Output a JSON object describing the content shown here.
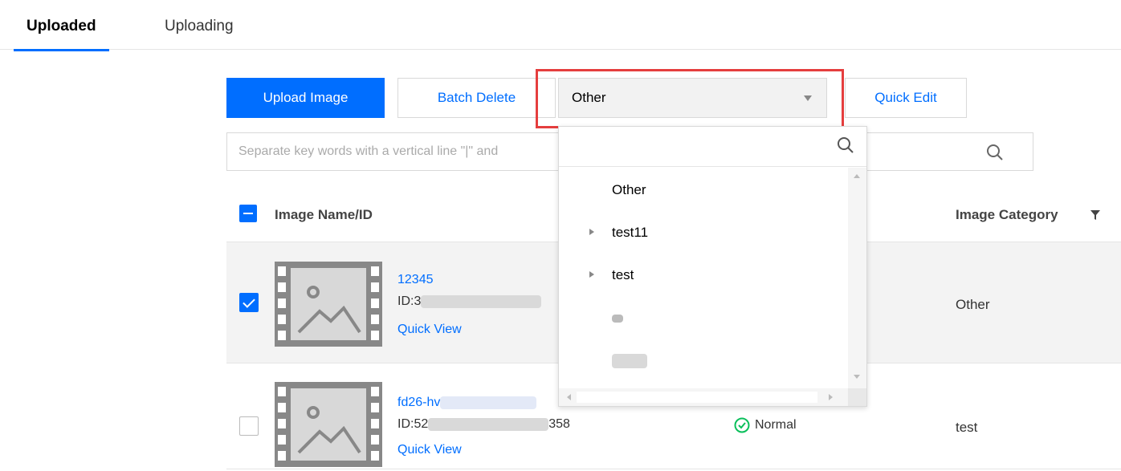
{
  "tabs": {
    "uploaded": "Uploaded",
    "uploading": "Uploading"
  },
  "toolbar": {
    "upload_label": "Upload Image",
    "batch_delete_label": "Batch Delete",
    "category_selected": "Other",
    "quick_edit_label": "Quick Edit"
  },
  "search": {
    "placeholder": "Separate key words with a vertical line \"|\" and"
  },
  "dropdown": {
    "search_placeholder": "",
    "items": [
      {
        "label": "Other",
        "expandable": false
      },
      {
        "label": "test11",
        "expandable": true
      },
      {
        "label": "test",
        "expandable": true
      },
      {
        "label": "",
        "expandable": false
      },
      {
        "label": "",
        "expandable": false
      }
    ]
  },
  "table": {
    "headers": {
      "name": "Image Name/ID",
      "category": "Image Category"
    },
    "rows": [
      {
        "name": "12345",
        "id_prefix": "ID:3",
        "id_suffix": "",
        "quick_view": "Quick View",
        "status": "",
        "category": "Other",
        "checked": true
      },
      {
        "name": "fd26-hv",
        "id_prefix": "ID:52",
        "id_suffix": "358",
        "quick_view": "Quick View",
        "status": "Normal",
        "category": "test",
        "checked": false
      }
    ]
  },
  "colors": {
    "primary": "#006eff",
    "highlight": "#e53e3e",
    "success": "#0abf5b"
  }
}
